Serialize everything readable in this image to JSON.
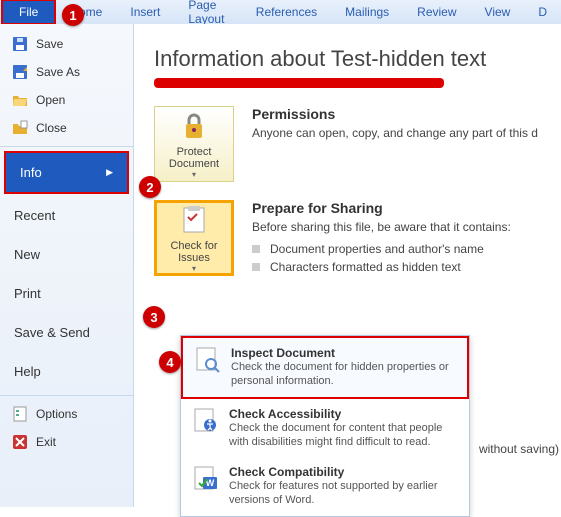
{
  "ribbon": {
    "tabs": [
      "File",
      "Home",
      "Insert",
      "Page Layout",
      "References",
      "Mailings",
      "Review",
      "View",
      "D"
    ]
  },
  "menu": {
    "save": "Save",
    "saveas": "Save As",
    "open": "Open",
    "close": "Close",
    "info": "Info",
    "recent": "Recent",
    "new": "New",
    "print": "Print",
    "savesend": "Save & Send",
    "help": "Help",
    "options": "Options",
    "exit": "Exit"
  },
  "main": {
    "title": "Information about Test-hidden  text",
    "permissions": {
      "heading": "Permissions",
      "body": "Anyone can open, copy, and change any part of this d"
    },
    "protect_btn": {
      "label": "Protect Document",
      "dd": "▾"
    },
    "prepare": {
      "heading": "Prepare for Sharing",
      "body": "Before sharing this file, be aware that it contains:",
      "bullets": [
        "Document properties and author's name",
        "Characters formatted as hidden text"
      ]
    },
    "check_btn": {
      "label": "Check for Issues",
      "dd": "▾"
    },
    "side_text": "without saving)"
  },
  "dropdown": {
    "items": [
      {
        "title": "Inspect Document",
        "desc": "Check the document for hidden properties or personal information."
      },
      {
        "title": "Check Accessibility",
        "desc": "Check the document for content that people with disabilities might find difficult to read."
      },
      {
        "title": "Check Compatibility",
        "desc": "Check for features not supported by earlier versions of Word."
      }
    ]
  },
  "badges": {
    "b1": "1",
    "b2": "2",
    "b3": "3",
    "b4": "4"
  }
}
